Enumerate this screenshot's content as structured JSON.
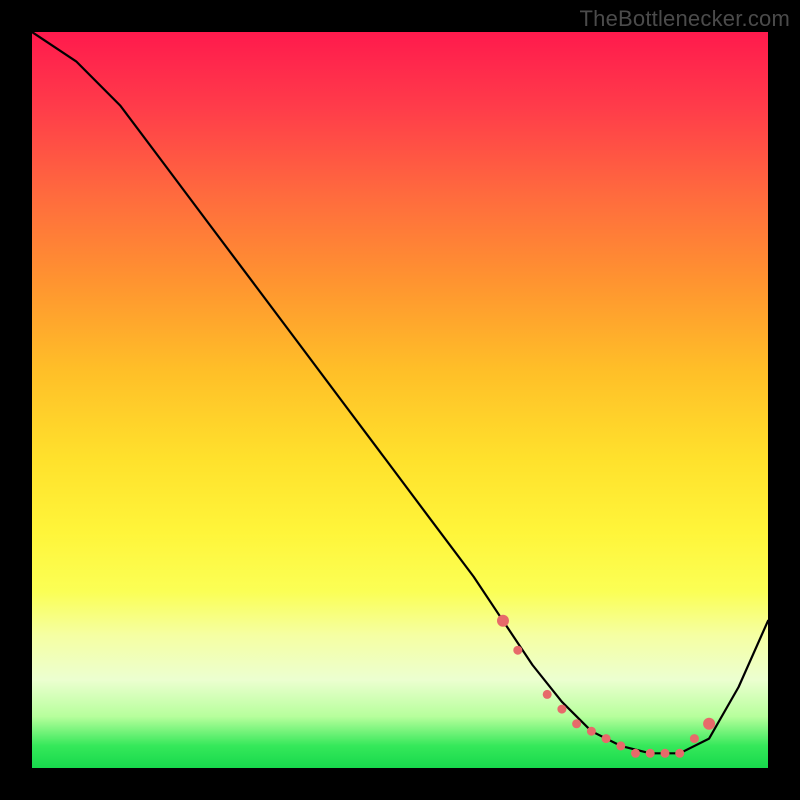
{
  "watermark": "TheBottlenecker.com",
  "chart_data": {
    "type": "line",
    "title": "",
    "xlabel": "",
    "ylabel": "",
    "xlim": [
      0,
      100
    ],
    "ylim": [
      0,
      100
    ],
    "grid": false,
    "series": [
      {
        "name": "curve",
        "x": [
          0,
          6,
          12,
          18,
          24,
          30,
          36,
          42,
          48,
          54,
          60,
          64,
          68,
          72,
          76,
          80,
          84,
          88,
          92,
          96,
          100
        ],
        "y": [
          100,
          96,
          90,
          82,
          74,
          66,
          58,
          50,
          42,
          34,
          26,
          20,
          14,
          9,
          5,
          3,
          2,
          2,
          4,
          11,
          20
        ]
      }
    ],
    "markers": {
      "name": "highlight-points",
      "color": "#e76a6a",
      "x": [
        64,
        66,
        70,
        72,
        74,
        76,
        78,
        80,
        82,
        84,
        86,
        88,
        90,
        92
      ],
      "y": [
        20,
        16,
        10,
        8,
        6,
        5,
        4,
        3,
        2,
        2,
        2,
        2,
        4,
        6
      ]
    }
  }
}
